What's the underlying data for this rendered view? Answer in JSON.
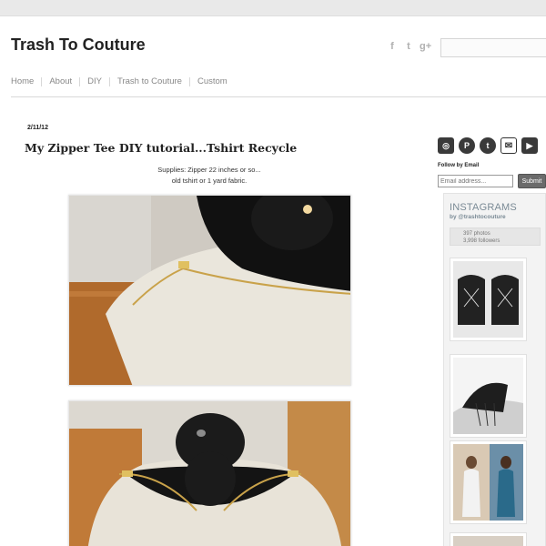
{
  "site": {
    "title": "Trash To Couture"
  },
  "social_icons": [
    "facebook-icon",
    "twitter-icon",
    "google-plus-icon"
  ],
  "nav": {
    "items": [
      "Home",
      "About",
      "DIY",
      "Trash to Couture",
      "Custom"
    ]
  },
  "post": {
    "date": "2/11/12",
    "title": "My Zipper Tee DIY tutorial...Tshirt Recycle",
    "supplies_line1": "Supplies: Zipper 22 inches or so...",
    "supplies_line2": "old tshirt or 1 yard fabric."
  },
  "sidebar": {
    "icons": [
      "instagram-icon",
      "pinterest-icon",
      "twitter-icon",
      "mail-icon",
      "youtube-icon"
    ],
    "follow_label": "Follow by Email",
    "email_placeholder": "Email address...",
    "submit_label": "Submit",
    "instagram": {
      "title": "INSTAGRAMS",
      "handle": "by @trashtocouture",
      "photos": "397 photos",
      "followers": "3,998 followers"
    }
  },
  "colors": {
    "accent_dark": "#3a3a3a",
    "submit_bg": "#6b6b6b",
    "instagram_text": "#7a8a95"
  }
}
